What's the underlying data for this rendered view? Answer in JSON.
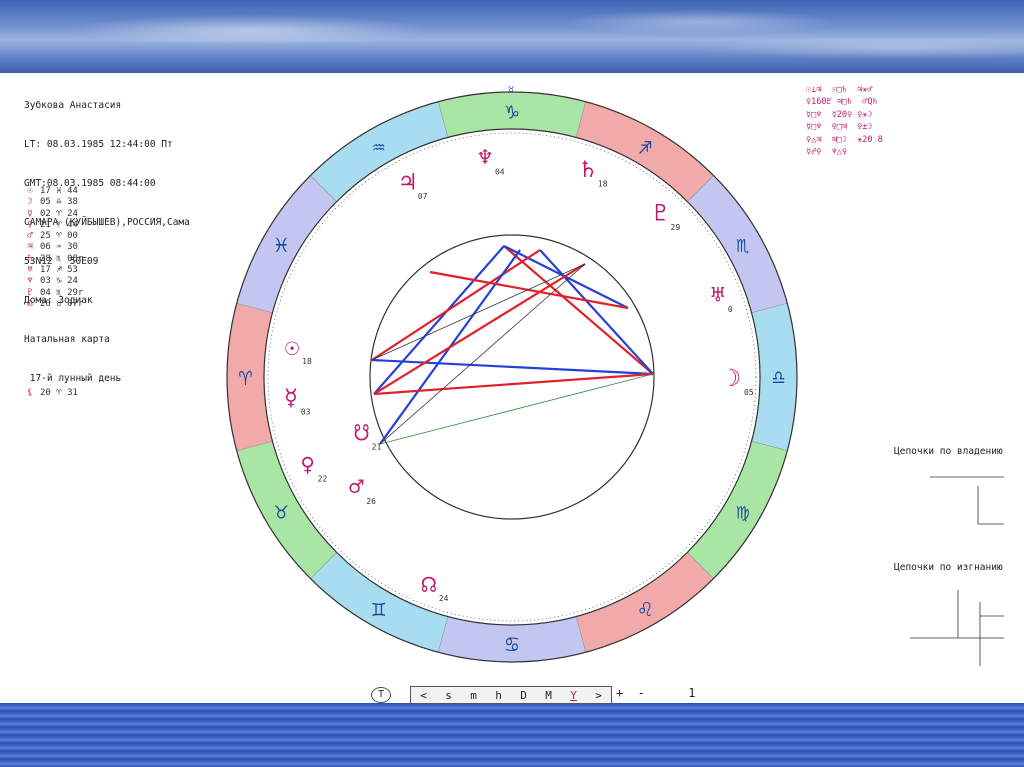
{
  "header": {
    "info_lines": [
      "Зубкова Анастасия",
      "LT: 08.03.1985 12:44:00 Пт",
      "GMT:08.03.1985 08:44:00",
      "САМАРА (КУЙБЫШЕВ),РОССИЯ,Сама",
      "53N12   50E09",
      "Дома: Зодиак",
      "Натальная карта",
      " 17-й лунный день"
    ]
  },
  "positions": [
    {
      "glyph": "☉",
      "text": "17 ♓ 44"
    },
    {
      "glyph": "☽",
      "text": "05 ♎ 38"
    },
    {
      "glyph": "☿",
      "text": "02 ♈ 24"
    },
    {
      "glyph": "♀",
      "text": "21 ♈ 44"
    },
    {
      "glyph": "♂",
      "text": "25 ♈ 00"
    },
    {
      "glyph": "♃",
      "text": "06 ♒ 30"
    },
    {
      "glyph": "♄",
      "text": "28 ♏ 08r"
    },
    {
      "glyph": "♅",
      "text": "17 ♐ 53"
    },
    {
      "glyph": "♆",
      "text": "03 ♑ 24"
    },
    {
      "glyph": "♇",
      "text": "04 ♏ 29r"
    },
    {
      "glyph": "☊",
      "text": "20 ♉ 07r"
    }
  ],
  "extra_position": {
    "glyph": "⚸",
    "text": "20 ♈ 31"
  },
  "aspects_rows": [
    "☉⊥♃  ☉□♄  ♃⚹♂",
    "♀160♇ ♃□♄  ♂Q♄",
    "☿□♆  ☿20♀ ♀⚹☽",
    "☿□♆  ♀□♃  ♀±☽",
    "♀△♃  ♃□☽  ⚹20 8",
    "☿☍♀  ♆△♀  "
  ],
  "chains": {
    "ownership_title": "Цепочки по владению",
    "exile_title": "Цепочки по изгнанию"
  },
  "toolbar": {
    "t_label": "T",
    "items": [
      "<",
      "s",
      "m",
      "h",
      "D",
      "M",
      "Y",
      ">"
    ],
    "plus_minus": "+  -",
    "value": "1"
  },
  "chart": {
    "zodiac_signs": [
      "♑",
      "♐",
      "♏",
      "♎",
      "♍",
      "♌",
      "♋",
      "♊",
      "♉",
      "♈",
      "♓",
      "♒"
    ],
    "planet_labels": [
      {
        "glyph": "♆",
        "deg": "04"
      },
      {
        "glyph": "♄",
        "deg": "18"
      },
      {
        "glyph": "♇",
        "deg": "29"
      },
      {
        "glyph": "♃",
        "deg": "07"
      },
      {
        "glyph": "♅",
        "deg": "0"
      },
      {
        "glyph": "☉",
        "deg": "18"
      },
      {
        "glyph": "☽",
        "deg": "05"
      },
      {
        "glyph": "☿",
        "deg": "03"
      },
      {
        "glyph": "♀",
        "deg": "22"
      },
      {
        "glyph": "♂",
        "deg": "26"
      },
      {
        "glyph": "☊",
        "deg": "24"
      },
      {
        "glyph": "☋",
        "deg": "21"
      }
    ],
    "colors": {
      "fire": "#f2a9a9",
      "earth": "#a9e5a4",
      "air": "#a8dcf0",
      "water": "#c2c6f0",
      "red_line": "#e0202a",
      "blue_line": "#2440d8",
      "glyph": "#c2186b"
    }
  }
}
